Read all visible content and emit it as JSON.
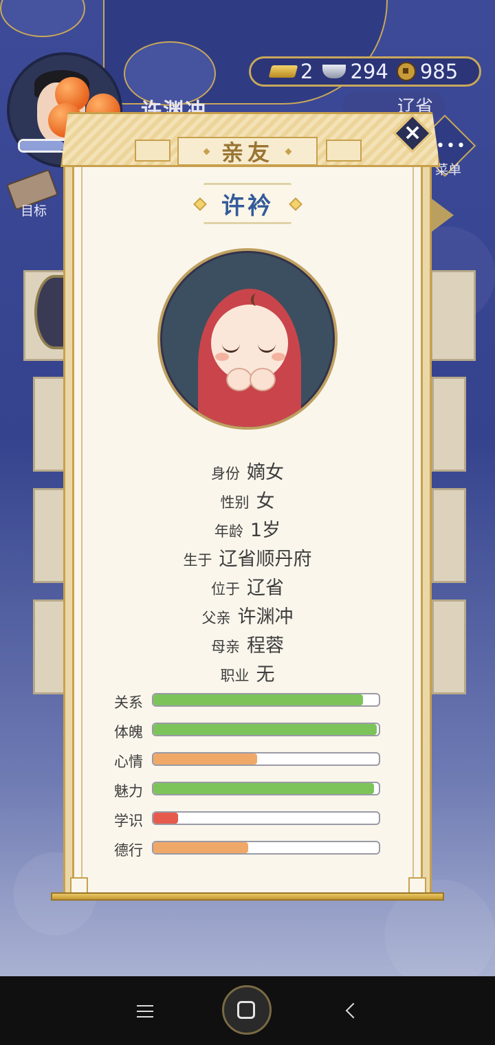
{
  "hud": {
    "player_name": "许渊冲",
    "gold": "2",
    "silver": "294",
    "coins": "985",
    "region": "辽省",
    "menu_label": "菜单",
    "goal_label": "目标"
  },
  "modal": {
    "title": "亲友",
    "close_icon": "close-icon",
    "character_name": "许衿",
    "info": [
      {
        "key": "身份",
        "value": "嫡女"
      },
      {
        "key": "性别",
        "value": "女"
      },
      {
        "key": "年龄",
        "value": "1岁"
      },
      {
        "key": "生于",
        "value": "辽省顺丹府"
      },
      {
        "key": "位于",
        "value": "辽省"
      },
      {
        "key": "父亲",
        "value": "许渊冲"
      },
      {
        "key": "母亲",
        "value": "程蓉"
      },
      {
        "key": "职业",
        "value": "无"
      }
    ],
    "stats": [
      {
        "label": "关系",
        "fill_percent": 93,
        "color": "#7cc45a"
      },
      {
        "label": "体魄",
        "fill_percent": 99,
        "color": "#7cc45a"
      },
      {
        "label": "心情",
        "fill_percent": 46,
        "color": "#f0a868"
      },
      {
        "label": "魅力",
        "fill_percent": 98,
        "color": "#7cc45a"
      },
      {
        "label": "学识",
        "fill_percent": 11,
        "color": "#e65a4c"
      },
      {
        "label": "德行",
        "fill_percent": 42,
        "color": "#f0a868"
      }
    ]
  },
  "nav": {
    "icons": [
      "menu-icon",
      "home-icon",
      "back-icon"
    ]
  }
}
